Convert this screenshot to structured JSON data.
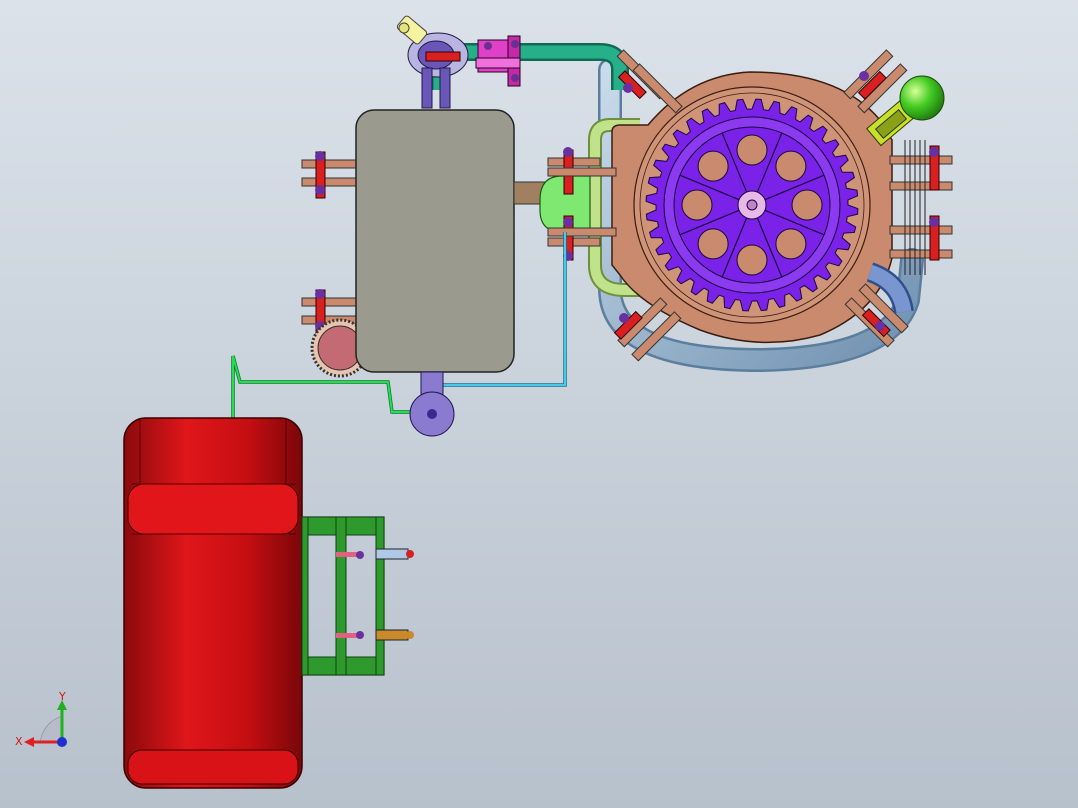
{
  "viewport": {
    "background_top": "#dbe2ea",
    "background_bottom": "#b7c1cc",
    "display_style": "shaded-with-edges"
  },
  "triad": {
    "x_label": "X",
    "y_label": "Y",
    "x_color": "#e02020",
    "y_color": "#20b020",
    "z_color": "#2030d0"
  },
  "parts": {
    "tank": {
      "color": "#9a9a8f"
    },
    "main_housing": {
      "color": "#c98a6e"
    },
    "gear": {
      "color": "#7a22e8",
      "teeth": 36,
      "bolt_holes": 8,
      "spokes": 8
    },
    "pipe_teal": {
      "color": "#26b08a"
    },
    "pipe_steel": {
      "color": "#8fb2d0"
    },
    "pipe_lightgreen": {
      "color": "#bfe28a"
    },
    "clamp_pink": {
      "color": "#e040c8"
    },
    "sensor_yellow": {
      "color": "#f5f2a0"
    },
    "ball_valve_green": {
      "color": "#44cc22"
    },
    "flow_meter": {
      "color": "#8a7ad0"
    },
    "pump_motor": {
      "color": "#c40e12"
    },
    "bracket": {
      "color": "#2e9a2e"
    },
    "small_gear": {
      "color": "#c46a72"
    },
    "line_green": {
      "color": "#22dd55"
    },
    "line_cyan": {
      "color": "#44ccee"
    }
  }
}
